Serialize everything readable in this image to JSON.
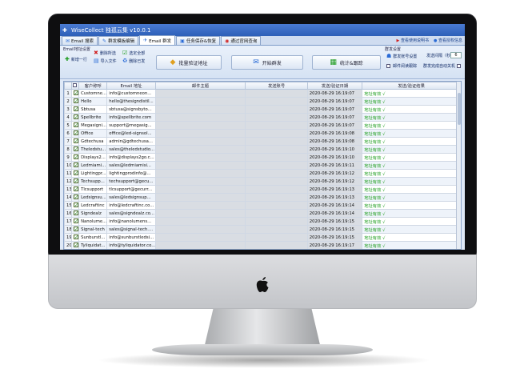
{
  "window": {
    "title": "WiseCollect 独孤云集 v10.0.1"
  },
  "tabs": [
    {
      "label": "Email 搜索"
    },
    {
      "label": "群发模板编辑"
    },
    {
      "label": "Email 群发"
    },
    {
      "label": "任务保存&恢复"
    },
    {
      "label": "通过官网查询"
    }
  ],
  "top_links": {
    "help": "查看使用说明书",
    "wechat": "查看授权信息"
  },
  "email_group": {
    "title": "Email地址设置",
    "new_row": "新增一行",
    "delete_selected": "删除所选",
    "select_all": "选定全部",
    "import_file": "导入文件",
    "clear_done": "删除已发"
  },
  "big_buttons": {
    "verify": "批量验证地址",
    "start_send": "开始群发",
    "stats": "统计&跟踪"
  },
  "send_group": {
    "title": "群发设置",
    "account_settings": "群发账号设置",
    "interval_label": "发送间隔（秒）",
    "interval_value": "6",
    "track_open": "邮件阅读跟踪",
    "shutdown": "群发完成自动关机"
  },
  "columns": [
    "",
    "客户称呼",
    "Email 地址",
    "邮件主题",
    "发送账号",
    "发送/验证日期",
    "发送/验证结果"
  ],
  "rows": [
    {
      "n": "1",
      "name": "Customne...",
      "email": "info@customneon...",
      "date": "2020-08-29 16:19:07",
      "result": "地址有效 √"
    },
    {
      "n": "2",
      "name": "Hello",
      "email": "hello@thesigndistil...",
      "date": "2020-08-29 16:19:07",
      "result": "地址有效 √"
    },
    {
      "n": "3",
      "name": "Sbtusa",
      "email": "sbtusa@signsbyto...",
      "date": "2020-08-29 16:19:07",
      "result": "地址有效 √"
    },
    {
      "n": "4",
      "name": "Spellbrite",
      "email": "info@spellbrite.com",
      "date": "2020-08-29 16:19:07",
      "result": "地址有效 √"
    },
    {
      "n": "5",
      "name": "Megasigni...",
      "email": "support@megasig...",
      "date": "2020-08-29 16:19:07",
      "result": "地址有效 √"
    },
    {
      "n": "6",
      "name": "Office",
      "email": "office@led-signsol...",
      "date": "2020-08-29 16:19:08",
      "result": "地址有效 √"
    },
    {
      "n": "7",
      "name": "Gdtechusa",
      "email": "admin@gdtechusa...",
      "date": "2020-08-29 16:19:08",
      "result": "地址有效 √"
    },
    {
      "n": "8",
      "name": "Theledstu...",
      "email": "sales@theledstudio...",
      "date": "2020-08-29 16:19:10",
      "result": "地址有效 √"
    },
    {
      "n": "9",
      "name": "Displays2...",
      "email": "info@displays2go.c...",
      "date": "2020-08-29 16:19:10",
      "result": "地址有效 √"
    },
    {
      "n": "10",
      "name": "Ledmiami...",
      "email": "sales@ledmiamisi...",
      "date": "2020-08-29 16:19:11",
      "result": "地址有效 √"
    },
    {
      "n": "11",
      "name": "Lightingpr...",
      "email": "lightingprodinfo@...",
      "date": "2020-08-29 16:19:12",
      "result": "地址有效 √"
    },
    {
      "n": "12",
      "name": "Techsupp...",
      "email": "techsupport@gecu...",
      "date": "2020-08-29 16:19:12",
      "result": "地址有效 √"
    },
    {
      "n": "13",
      "name": "Tlcsupport",
      "email": "tlcsupport@gecurr...",
      "date": "2020-08-29 16:19:13",
      "result": "地址有效 √"
    },
    {
      "n": "14",
      "name": "Ledsignsu...",
      "email": "sales@ledsignsup...",
      "date": "2020-08-29 16:19:13",
      "result": "地址有效 √"
    },
    {
      "n": "15",
      "name": "Ledcraftinc",
      "email": "info@ledcraftinc.co...",
      "date": "2020-08-29 16:19:14",
      "result": "地址有效 √"
    },
    {
      "n": "16",
      "name": "Signdealz",
      "email": "sales@signdealz.co...",
      "date": "2020-08-29 16:19:14",
      "result": "地址有效 √"
    },
    {
      "n": "17",
      "name": "Nanolume...",
      "email": "info@nanolumens...",
      "date": "2020-08-29 16:19:15",
      "result": "地址有效 √"
    },
    {
      "n": "18",
      "name": "Signal-tech",
      "email": "sales@signal-tech....",
      "date": "2020-08-29 16:19:15",
      "result": "地址有效 √"
    },
    {
      "n": "19",
      "name": "Sunburstl...",
      "email": "info@sunburstledsi...",
      "date": "2020-08-29 16:19:15",
      "result": "地址有效 √"
    },
    {
      "n": "20",
      "name": "Tyliquidat...",
      "email": "info@tyliquidator.co...",
      "date": "2020-08-29 16:19:17",
      "result": "地址有效 √"
    }
  ]
}
